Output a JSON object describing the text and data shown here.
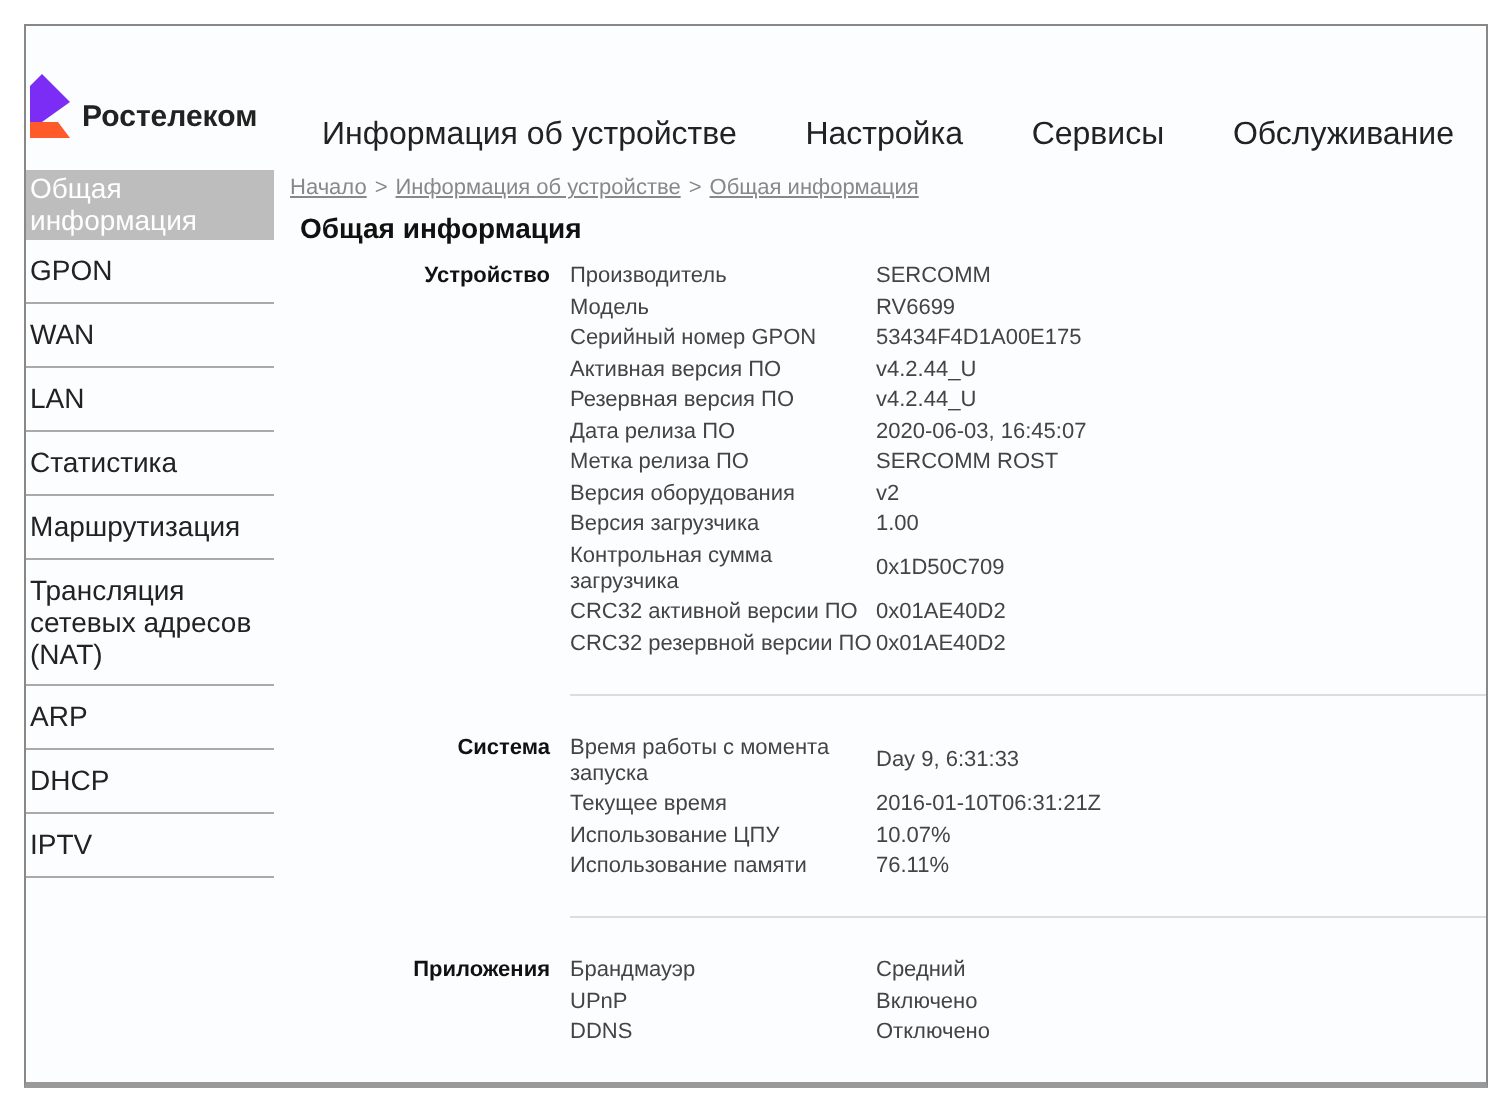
{
  "logo": {
    "text": "Ростелеком"
  },
  "nav": [
    {
      "label": "Информация об устройстве"
    },
    {
      "label": "Настройка"
    },
    {
      "label": "Сервисы"
    },
    {
      "label": "Обслуживание"
    }
  ],
  "sidebar": {
    "items": [
      {
        "label": "Общая информация",
        "selected": true
      },
      {
        "label": "GPON",
        "selected": false
      },
      {
        "label": "WAN",
        "selected": false
      },
      {
        "label": "LAN",
        "selected": false
      },
      {
        "label": "Статистика",
        "selected": false
      },
      {
        "label": "Маршрутизация",
        "selected": false
      },
      {
        "label": "Трансляция сетевых адресов (NAT)",
        "selected": false
      },
      {
        "label": "ARP",
        "selected": false
      },
      {
        "label": "DHCP",
        "selected": false
      },
      {
        "label": "IPTV",
        "selected": false
      }
    ]
  },
  "breadcrumb": [
    "Начало",
    "Информация об устройстве",
    "Общая информация"
  ],
  "breadcrumb_separator": ">",
  "page_title": "Общая информация",
  "sections": [
    {
      "title": "Устройство",
      "rows": [
        {
          "key": "Производитель",
          "value": "SERCOMM"
        },
        {
          "key": "Модель",
          "value": "RV6699"
        },
        {
          "key": "Серийный номер GPON",
          "value": "53434F4D1A00E175"
        },
        {
          "key": "Активная версия ПО",
          "value": "v4.2.44_U"
        },
        {
          "key": "Резервная версия ПО",
          "value": "v4.2.44_U"
        },
        {
          "key": "Дата релиза ПО",
          "value": "2020-06-03, 16:45:07"
        },
        {
          "key": "Метка релиза ПО",
          "value": "SERCOMM ROST"
        },
        {
          "key": "Версия оборудования",
          "value": "v2"
        },
        {
          "key": "Версия загрузчика",
          "value": "1.00"
        },
        {
          "key": "Контрольная сумма загрузчика",
          "value": "0x1D50C709"
        },
        {
          "key": "CRC32 активной версии ПО",
          "value": "0x01AE40D2"
        },
        {
          "key": "CRC32 резервной версии ПО",
          "value": "0x01AE40D2"
        }
      ]
    },
    {
      "title": "Система",
      "rows": [
        {
          "key": "Время работы с момента запуска",
          "value": "Day 9, 6:31:33"
        },
        {
          "key": "Текущее время",
          "value": "2016-01-10T06:31:21Z"
        },
        {
          "key": "Использование ЦПУ",
          "value": "10.07%"
        },
        {
          "key": "Использование памяти",
          "value": "76.11%"
        }
      ]
    },
    {
      "title": "Приложения",
      "rows": [
        {
          "key": "Брандмауэр",
          "value": "Средний"
        },
        {
          "key": "UPnP",
          "value": "Включено"
        },
        {
          "key": "DDNS",
          "value": "Отключено"
        }
      ]
    }
  ]
}
